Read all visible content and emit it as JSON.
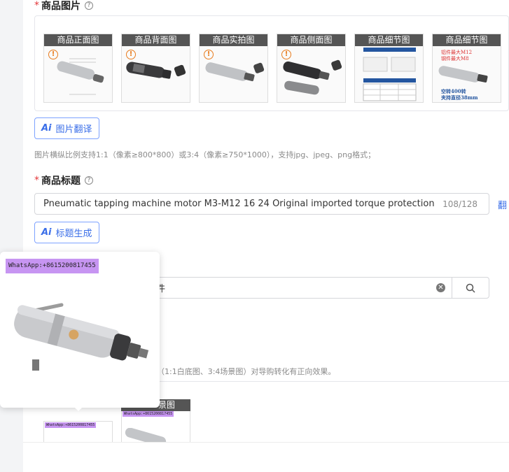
{
  "product_images": {
    "label": "商品图片",
    "thumbnails": [
      {
        "caption": "商品正面图"
      },
      {
        "caption": "商品背面图"
      },
      {
        "caption": "商品实拍图"
      },
      {
        "caption": "商品侧面图"
      },
      {
        "caption": "商品细节图"
      },
      {
        "caption": "商品细节图"
      }
    ],
    "detail_text_1": "铝件最大M12",
    "detail_text_2": "钢件最大M8",
    "detail_text_3": "空转400转",
    "detail_text_4": "夹持直径38mm",
    "translate_button": "图片翻译",
    "hint": "图片横纵比例支持1:1（像素≥800*800）或3:4（像素≥750*1000），支持jpg、jpeg、png格式；"
  },
  "product_title": {
    "label": "商品标题",
    "value": "Pneumatic tapping machine motor M3-M12 16 24 Original imported torque protection chuck",
    "count": "108/128",
    "translate_link": "翻",
    "generate_button": "标题生成"
  },
  "search": {
    "value": "件"
  },
  "section_hint": "（1:1白底图、3:4场景图）对导购转化有正向效果。",
  "preview_popover": {
    "watermark": "WhatsApp:+8615200817455"
  },
  "bottom_images": {
    "second_caption": "景图"
  },
  "colors": {
    "accent": "#3a6ee8",
    "required": "#e4393c",
    "watermark": "#c795f2"
  }
}
